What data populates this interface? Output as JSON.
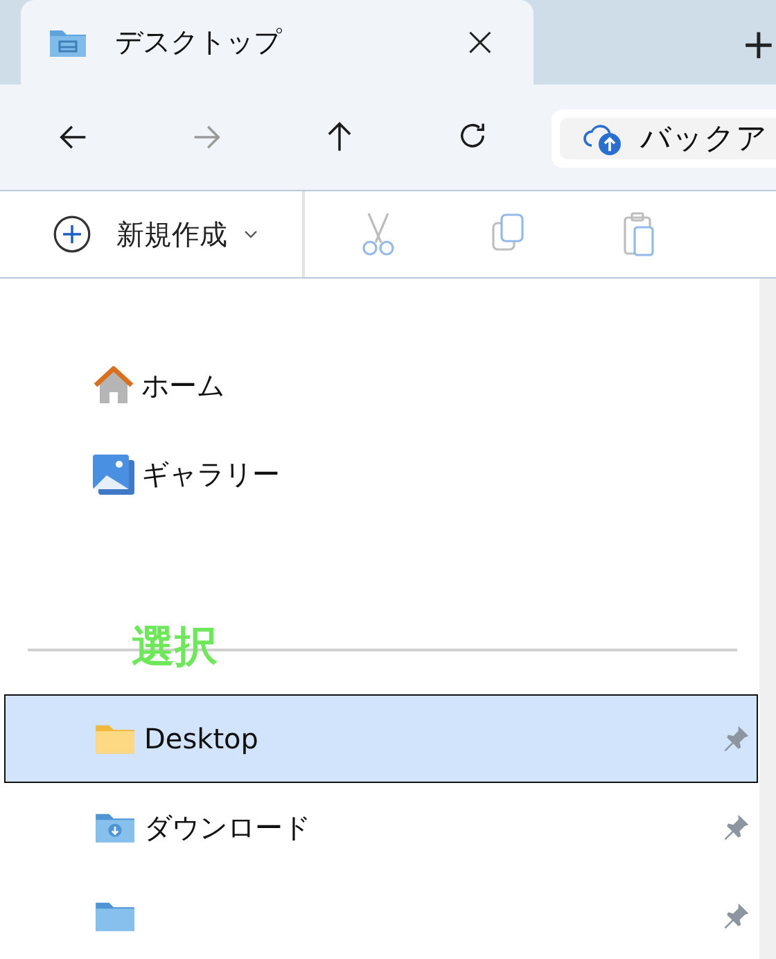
{
  "tab": {
    "title": "デスクトップ",
    "close": "×",
    "new_tab": "+"
  },
  "nav": [
    {
      "kind": "back",
      "disabled": false
    },
    {
      "kind": "forward",
      "disabled": true
    },
    {
      "kind": "up",
      "disabled": false
    },
    {
      "kind": "refresh",
      "disabled": false
    }
  ],
  "address": {
    "text": "バックア"
  },
  "command_bar": {
    "new": {
      "label": "新規作成"
    },
    "actions": [
      {
        "kind": "cut",
        "disabled": true
      },
      {
        "kind": "copy",
        "disabled": true
      },
      {
        "kind": "paste",
        "disabled": true
      }
    ]
  },
  "sidebar": {
    "top_items": [
      {
        "kind": "home",
        "label": "ホーム"
      },
      {
        "kind": "gallery",
        "label": "ギャラリー"
      }
    ],
    "annotation": "選択",
    "pinned_items": [
      {
        "kind": "folder",
        "label": "Desktop",
        "selected": true,
        "pinned": true
      },
      {
        "kind": "download",
        "label": "ダウンロード",
        "selected": false,
        "pinned": true
      },
      {
        "kind": "documents",
        "selected": false,
        "pinned": true
      }
    ]
  }
}
